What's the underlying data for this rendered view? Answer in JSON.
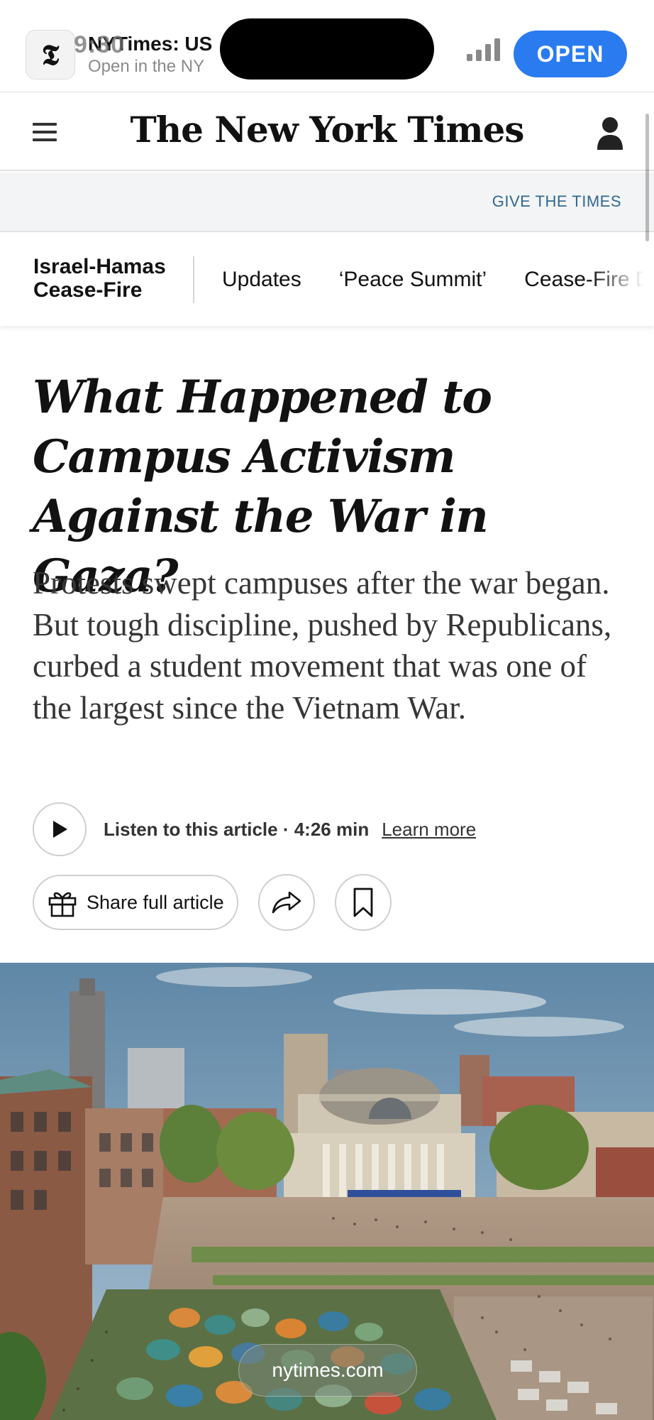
{
  "status_bar": {
    "time": "9:30"
  },
  "app_banner": {
    "icon_letter": "𝕿",
    "app_name": "NYTimes: US",
    "subtitle": "Open in the NY",
    "open_label": "OPEN"
  },
  "masthead": {
    "logo": "The New York Times",
    "menu_icon": "hamburger-menu-icon",
    "account_icon": "account-icon"
  },
  "give_bar": {
    "label": "GIVE THE TIMES"
  },
  "topic_bar": {
    "title": "Israel-Hamas Cease-Fire",
    "links": [
      "Updates",
      "‘Peace Summit’",
      "Cease-Fire Deal"
    ]
  },
  "article": {
    "headline": "What Happened to Campus Activism Against the War in Gaza?",
    "summary": "Protests swept campuses after the war began. But tough discipline, pushed by Republicans, curbed a student movement that was one of the largest since the Vietnam War.",
    "listen_text": "Listen to this article · 4:26 min",
    "learn_more": "Learn more",
    "share_label": "Share full article"
  },
  "browser": {
    "url": "nytimes.com"
  },
  "colors": {
    "open_button": "#2b7bf0",
    "give_link": "#326891"
  }
}
